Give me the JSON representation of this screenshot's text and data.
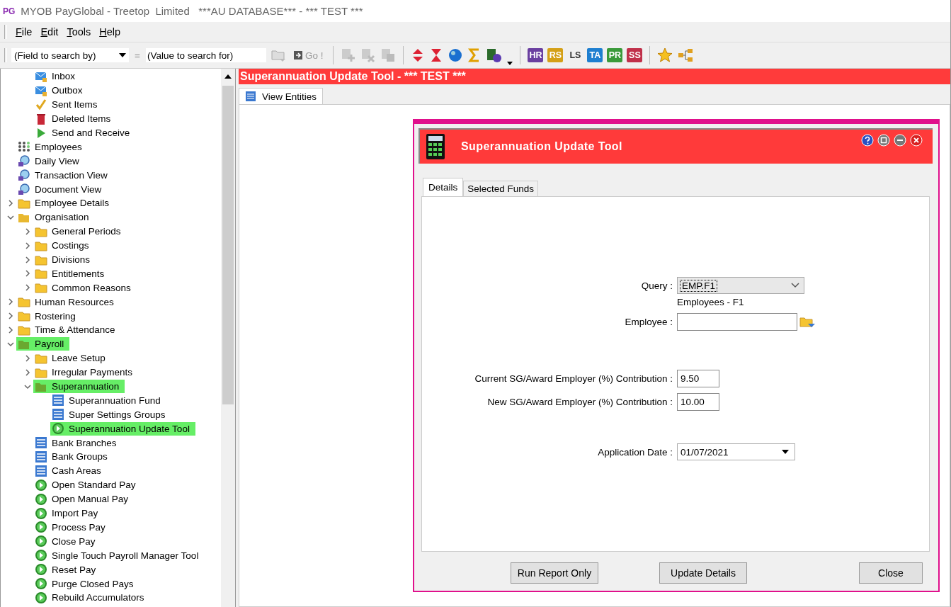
{
  "window": {
    "title": "MYOB PayGlobal - Treetop  Limited   ***AU DATABASE*** - *** TEST ***",
    "logo": "PG"
  },
  "menu": [
    {
      "label": "File"
    },
    {
      "label": "Edit"
    },
    {
      "label": "Tools"
    },
    {
      "label": "Help"
    }
  ],
  "search": {
    "field_placeholder": "(Field to search by)",
    "equals": "=",
    "value_placeholder": "(Value to search for)",
    "go": "Go !"
  },
  "modules": [
    {
      "label": "HR",
      "color": "#6a3fa0"
    },
    {
      "label": "RS",
      "color": "#d4a017"
    },
    {
      "label": "LS",
      "color": "#333333"
    },
    {
      "label": "TA",
      "color": "#1e7fd0"
    },
    {
      "label": "PR",
      "color": "#3a9a3a"
    },
    {
      "label": "SS",
      "color": "#c0304a"
    }
  ],
  "tree": [
    {
      "children": [
        {
          "label": "Inbox",
          "kind": "mail",
          "selected": false
        },
        {
          "label": "Outbox",
          "kind": "mail",
          "selected": false
        },
        {
          "label": "Sent Items",
          "kind": "sent",
          "selected": false
        },
        {
          "label": "Deleted Items",
          "kind": "trash",
          "selected": false
        },
        {
          "label": "Send and Receive",
          "kind": "send",
          "selected": false
        }
      ]
    },
    {
      "label": "Employees",
      "kind": "people",
      "selected": false
    },
    {
      "label": "Daily View",
      "kind": "view",
      "selected": false
    },
    {
      "label": "Transaction View",
      "kind": "view",
      "selected": false
    },
    {
      "label": "Document View",
      "kind": "view",
      "selected": false
    },
    {
      "label": "Employee Details",
      "kind": "folder",
      "expanded": false,
      "selected": false
    },
    {
      "label": "Organisation",
      "kind": "folder",
      "expanded": true,
      "selected": false,
      "children": [
        {
          "label": "General Periods",
          "kind": "folder",
          "expanded": false,
          "selected": false
        },
        {
          "label": "Costings",
          "kind": "folder",
          "expanded": false,
          "selected": false
        },
        {
          "label": "Divisions",
          "kind": "folder",
          "expanded": false,
          "selected": false
        },
        {
          "label": "Entitlements",
          "kind": "folder",
          "expanded": false,
          "selected": false
        },
        {
          "label": "Common Reasons",
          "kind": "folder",
          "expanded": false,
          "selected": false
        }
      ]
    },
    {
      "label": "Human Resources",
      "kind": "folder",
      "expanded": false,
      "selected": false
    },
    {
      "label": "Rostering",
      "kind": "folder",
      "expanded": false,
      "selected": false
    },
    {
      "label": "Time & Attendance",
      "kind": "folder",
      "expanded": false,
      "selected": false
    },
    {
      "label": "Payroll",
      "kind": "folder",
      "expanded": true,
      "selected": true,
      "children": [
        {
          "label": "Leave Setup",
          "kind": "folder",
          "expanded": false,
          "selected": false
        },
        {
          "label": "Irregular Payments",
          "kind": "folder",
          "expanded": false,
          "selected": false
        },
        {
          "label": "Superannuation",
          "kind": "folder",
          "expanded": true,
          "selected": true,
          "children": [
            {
              "label": "Superannuation Fund",
              "kind": "list",
              "selected": false
            },
            {
              "label": "Super Settings Groups",
              "kind": "list",
              "selected": false
            },
            {
              "label": "Superannuation Update Tool",
              "kind": "run",
              "selected": true
            }
          ]
        },
        {
          "label": "Bank Branches",
          "kind": "list",
          "selected": false
        },
        {
          "label": "Bank Groups",
          "kind": "list",
          "selected": false
        },
        {
          "label": "Cash Areas",
          "kind": "list",
          "selected": false
        },
        {
          "label": "Open Standard Pay",
          "kind": "run",
          "selected": false
        },
        {
          "label": "Open Manual Pay",
          "kind": "run",
          "selected": false
        },
        {
          "label": "Import Pay",
          "kind": "run",
          "selected": false
        },
        {
          "label": "Process Pay",
          "kind": "run",
          "selected": false
        },
        {
          "label": "Close Pay",
          "kind": "run",
          "selected": false
        },
        {
          "label": "Single Touch Payroll Manager Tool",
          "kind": "run",
          "selected": false
        },
        {
          "label": "Reset Pay",
          "kind": "run",
          "selected": false
        },
        {
          "label": "Purge Closed Pays",
          "kind": "run",
          "selected": false
        },
        {
          "label": "Rebuild Accumulators",
          "kind": "run",
          "selected": false
        }
      ]
    }
  ],
  "content": {
    "title": "Superannuation Update Tool - *** TEST ***",
    "tabs": [
      {
        "label": "View Entities",
        "selected": true
      }
    ]
  },
  "dialog": {
    "title": "Superannuation Update Tool",
    "tabs": [
      {
        "label": "Details",
        "selected": true
      },
      {
        "label": "Selected Funds",
        "selected": false
      }
    ],
    "query": {
      "label": "Query :",
      "value": "EMP.F1",
      "description": "Employees - F1"
    },
    "employee": {
      "label": "Employee :"
    },
    "current": {
      "label": "Current SG/Award Employer (%) Contribution :",
      "value": "9.50"
    },
    "new": {
      "label": "New SG/Award Employer (%) Contribution :",
      "value": "10.00"
    },
    "date": {
      "label": "Application Date :",
      "value": "01/07/2021"
    },
    "buttons": [
      "Run Report Only",
      "Update Details",
      "Close"
    ]
  }
}
